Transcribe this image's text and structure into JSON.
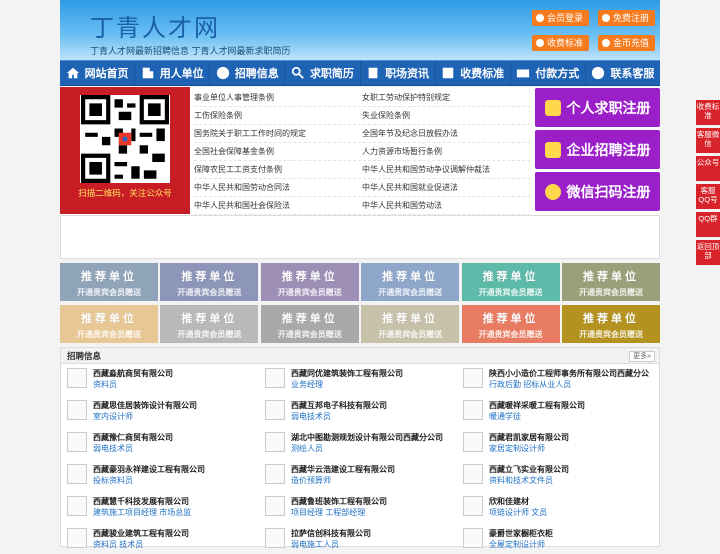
{
  "header": {
    "logo": "丁青人才网",
    "slogan": "丁青人才网最新招聘信息   丁青人才网最新求职简历",
    "buttons": [
      {
        "label": "会员登录"
      },
      {
        "label": "免费注册"
      },
      {
        "label": "收费标准"
      },
      {
        "label": "金币充值"
      }
    ]
  },
  "nav": [
    "网站首页",
    "用人单位",
    "招聘信息",
    "求职简历",
    "职场资讯",
    "收费标准",
    "付款方式",
    "联系客服"
  ],
  "qr": {
    "caption": "扫描二维码，关注公众号"
  },
  "links": [
    [
      "事业单位人事管理条例",
      "女职工劳动保护特别规定"
    ],
    [
      "工伤保险条例",
      "失业保险条例"
    ],
    [
      "国务院关于职工工作时间的规定",
      "全国年节及纪念日放假办法"
    ],
    [
      "全国社会保障基金条例",
      "人力资源市场暂行条例"
    ],
    [
      "保障农民工工资支付条例",
      "中华人民共和国劳动争议调解仲裁法"
    ],
    [
      "中华人民共和国劳动合同法",
      "中华人民共和国就业促进法"
    ],
    [
      "中华人民共和国社会保险法",
      "中华人民共和国劳动法"
    ]
  ],
  "register": [
    "个人求职注册",
    "企业招聘注册",
    "微信扫码注册"
  ],
  "promo": {
    "title": "推荐单位",
    "sub": "开通贵宾会员赠送",
    "colors": [
      "#8fa4b9",
      "#8d95b8",
      "#9e8fb6",
      "#8ea6c9",
      "#5db9a8",
      "#9aa17a",
      "#e7c794",
      "#b9b9b9",
      "#a9a9a9",
      "#c7c1a9",
      "#e87c62",
      "#b3921f"
    ]
  },
  "jobs": {
    "title": "招聘信息",
    "more": "更多»",
    "items": [
      [
        "西藏淼航商贸有限公司",
        "资料员"
      ],
      [
        "西藏同优建筑装饰工程有限公司",
        "业务经理"
      ],
      [
        "陕西小小造价工程师事务所有限公司西藏分公",
        "行政后勤 招标从业人员"
      ],
      [
        "西藏思佳居装饰设计有限公司",
        "室内设计师"
      ],
      [
        "西藏互邦电子科技有限公司",
        "弱电技术员"
      ],
      [
        "西藏暖祥采暖工程有限公司",
        "暖通学徒"
      ],
      [
        "西藏豫仁商贸有限公司",
        "弱电技术员"
      ],
      [
        "湖北中图勘测规划设计有限公司西藏分公司",
        "测绘人员"
      ],
      [
        "西藏君凯家居有限公司",
        "家居定制设计师"
      ],
      [
        "西藏豪羽永祥建设工程有限公司",
        "投标资料员"
      ],
      [
        "西藏华云浩建设工程有限公司",
        "造价预算师"
      ],
      [
        "西藏立飞实业有限公司",
        "资料和技术文件员"
      ],
      [
        "西藏慧千科技发展有限公司",
        "建筑施工项目经理 市场总监"
      ],
      [
        "西藏鲁班装饰工程有限公司",
        "项目经理 工程部经理"
      ],
      [
        "欣和佳建材",
        "项链设计师 文员"
      ],
      [
        "西藏骏业建筑工程有限公司",
        "资料员 技术员"
      ],
      [
        "拉萨信创科技有限公司",
        "弱电施工人员"
      ],
      [
        "豪爵世家橱柜衣柜",
        "全屋定制设计师"
      ]
    ]
  },
  "side": [
    "收费标准",
    "客服微信",
    "公众号",
    "客服QQ号",
    "QQ群",
    "返回顶部"
  ]
}
